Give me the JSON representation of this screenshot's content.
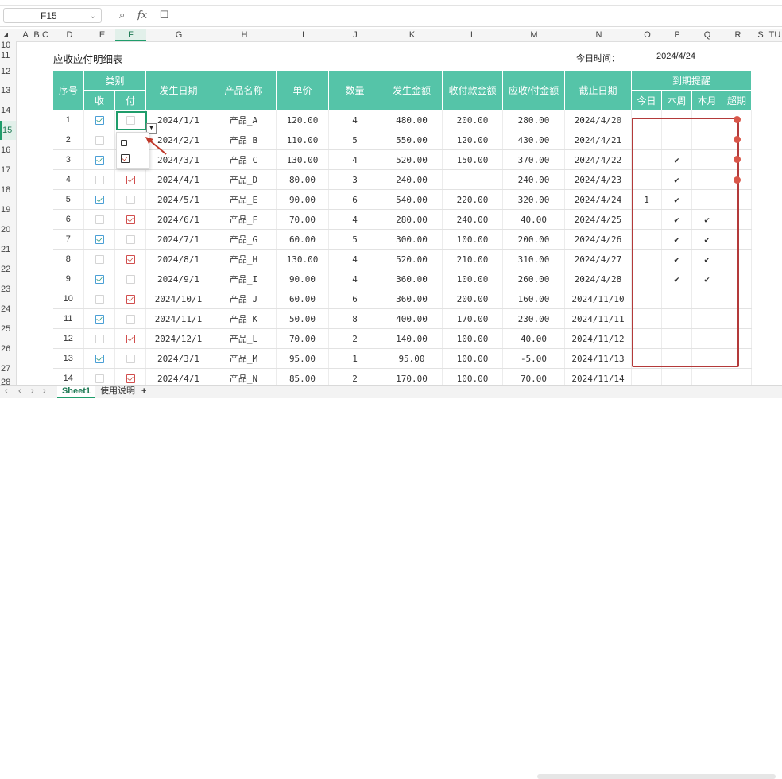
{
  "formula_bar": {
    "cell_ref": "F15",
    "fx_label": "fx"
  },
  "columns": [
    "A",
    "B",
    "C",
    "D",
    "E",
    "F",
    "G",
    "H",
    "I",
    "J",
    "K",
    "L",
    "M",
    "N",
    "O",
    "P",
    "Q",
    "R",
    "S",
    "TU"
  ],
  "rows": [
    "10",
    "11",
    "12",
    "13",
    "14",
    "15",
    "16",
    "17",
    "18",
    "19",
    "20",
    "21",
    "22",
    "23",
    "24",
    "25",
    "26",
    "27",
    "28"
  ],
  "sheet": {
    "title": "应收应付明细表",
    "today_label": "今日时间：",
    "today_value": "2024/4/24"
  },
  "table": {
    "headers": {
      "seq": "序号",
      "category": "类别",
      "receive": "收",
      "pay": "付",
      "date": "发生日期",
      "product": "产品名称",
      "price": "单价",
      "qty": "数量",
      "amount": "发生金额",
      "paid": "收付款金额",
      "balance": "应收/付金额",
      "deadline": "截止日期",
      "reminder": "到期提醒",
      "today": "今日",
      "this_week": "本周",
      "this_month": "本月",
      "overdue": "超期"
    },
    "rows": [
      {
        "seq": "1",
        "recv": true,
        "pay": false,
        "date": "2024/1/1",
        "product": "产品_A",
        "price": "120.00",
        "qty": "4",
        "amount": "480.00",
        "paid": "200.00",
        "balance": "280.00",
        "deadline": "2024/4/20",
        "today": "",
        "week": "",
        "month": "",
        "overdue": true
      },
      {
        "seq": "2",
        "recv": false,
        "pay": false,
        "date": "2024/2/1",
        "product": "产品_B",
        "price": "110.00",
        "qty": "5",
        "amount": "550.00",
        "paid": "120.00",
        "balance": "430.00",
        "deadline": "2024/4/21",
        "today": "",
        "week": "",
        "month": "",
        "overdue": true
      },
      {
        "seq": "3",
        "recv": true,
        "pay": false,
        "date": "2024/3/1",
        "product": "产品_C",
        "price": "130.00",
        "qty": "4",
        "amount": "520.00",
        "paid": "150.00",
        "balance": "370.00",
        "deadline": "2024/4/22",
        "today": "",
        "week": "✔",
        "month": "",
        "overdue": true
      },
      {
        "seq": "4",
        "recv": false,
        "pay": true,
        "date": "2024/4/1",
        "product": "产品_D",
        "price": "80.00",
        "qty": "3",
        "amount": "240.00",
        "paid": "−",
        "balance": "240.00",
        "deadline": "2024/4/23",
        "today": "",
        "week": "✔",
        "month": "",
        "overdue": true
      },
      {
        "seq": "5",
        "recv": true,
        "pay": false,
        "date": "2024/5/1",
        "product": "产品_E",
        "price": "90.00",
        "qty": "6",
        "amount": "540.00",
        "paid": "220.00",
        "balance": "320.00",
        "deadline": "2024/4/24",
        "today": "1",
        "week": "✔",
        "month": "",
        "overdue": false
      },
      {
        "seq": "6",
        "recv": false,
        "pay": true,
        "date": "2024/6/1",
        "product": "产品_F",
        "price": "70.00",
        "qty": "4",
        "amount": "280.00",
        "paid": "240.00",
        "balance": "40.00",
        "deadline": "2024/4/25",
        "today": "",
        "week": "✔",
        "month": "✔",
        "overdue": false
      },
      {
        "seq": "7",
        "recv": true,
        "pay": false,
        "date": "2024/7/1",
        "product": "产品_G",
        "price": "60.00",
        "qty": "5",
        "amount": "300.00",
        "paid": "100.00",
        "balance": "200.00",
        "deadline": "2024/4/26",
        "today": "",
        "week": "✔",
        "month": "✔",
        "overdue": false
      },
      {
        "seq": "8",
        "recv": false,
        "pay": true,
        "date": "2024/8/1",
        "product": "产品_H",
        "price": "130.00",
        "qty": "4",
        "amount": "520.00",
        "paid": "210.00",
        "balance": "310.00",
        "deadline": "2024/4/27",
        "today": "",
        "week": "✔",
        "month": "✔",
        "overdue": false
      },
      {
        "seq": "9",
        "recv": true,
        "pay": false,
        "date": "2024/9/1",
        "product": "产品_I",
        "price": "90.00",
        "qty": "4",
        "amount": "360.00",
        "paid": "100.00",
        "balance": "260.00",
        "deadline": "2024/4/28",
        "today": "",
        "week": "✔",
        "month": "✔",
        "overdue": false
      },
      {
        "seq": "10",
        "recv": false,
        "pay": true,
        "date": "2024/10/1",
        "product": "产品_J",
        "price": "60.00",
        "qty": "6",
        "amount": "360.00",
        "paid": "200.00",
        "balance": "160.00",
        "deadline": "2024/11/10",
        "today": "",
        "week": "",
        "month": "",
        "overdue": false
      },
      {
        "seq": "11",
        "recv": true,
        "pay": false,
        "date": "2024/11/1",
        "product": "产品_K",
        "price": "50.00",
        "qty": "8",
        "amount": "400.00",
        "paid": "170.00",
        "balance": "230.00",
        "deadline": "2024/11/11",
        "today": "",
        "week": "",
        "month": "",
        "overdue": false
      },
      {
        "seq": "12",
        "recv": false,
        "pay": true,
        "date": "2024/12/1",
        "product": "产品_L",
        "price": "70.00",
        "qty": "2",
        "amount": "140.00",
        "paid": "100.00",
        "balance": "40.00",
        "deadline": "2024/11/12",
        "today": "",
        "week": "",
        "month": "",
        "overdue": false
      },
      {
        "seq": "13",
        "recv": true,
        "pay": false,
        "date": "2024/3/1",
        "product": "产品_M",
        "price": "95.00",
        "qty": "1",
        "amount": "95.00",
        "paid": "100.00",
        "balance": "-5.00",
        "deadline": "2024/11/13",
        "today": "",
        "week": "",
        "month": "",
        "overdue": false
      },
      {
        "seq": "14",
        "recv": false,
        "pay": true,
        "date": "2024/4/1",
        "product": "产品_N",
        "price": "85.00",
        "qty": "2",
        "amount": "170.00",
        "paid": "100.00",
        "balance": "70.00",
        "deadline": "2024/11/14",
        "today": "",
        "week": "",
        "month": "",
        "overdue": false
      }
    ]
  },
  "tabs": {
    "sheet1": "Sheet1",
    "sheet2": "使用说明",
    "add": "+"
  },
  "colors": {
    "header_bg": "#55c4a8",
    "accent": "#1f9d6b",
    "alert": "#b33a3a"
  }
}
